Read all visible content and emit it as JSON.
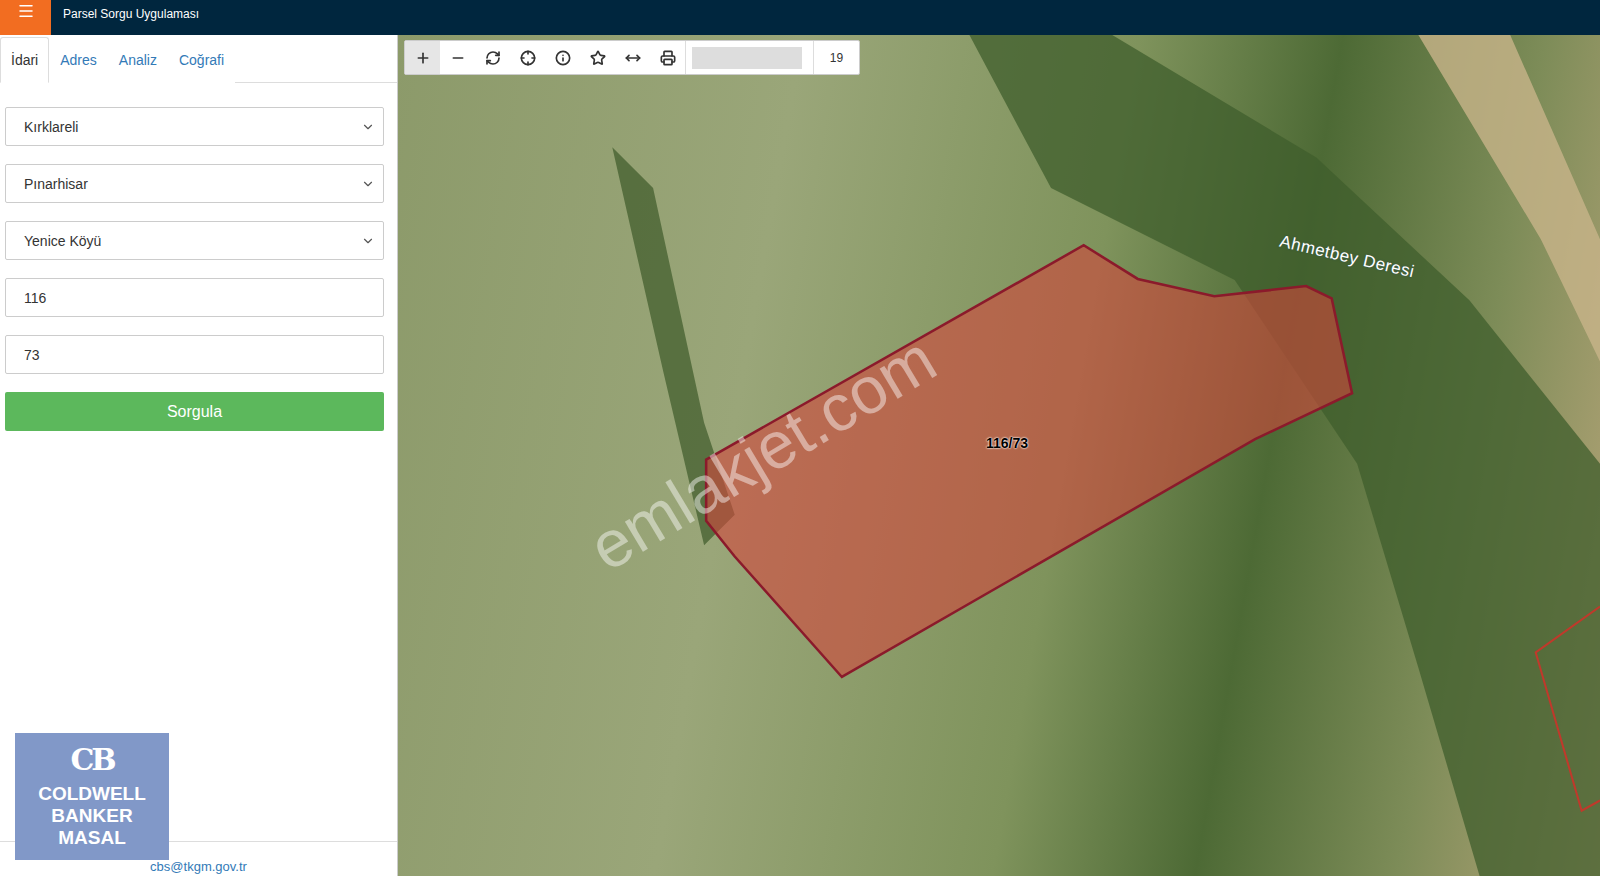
{
  "header": {
    "title": "Parsel Sorgu Uygulaması"
  },
  "tabs": [
    {
      "label": "İdari",
      "selected": true
    },
    {
      "label": "Adres",
      "selected": false
    },
    {
      "label": "Analiz",
      "selected": false
    },
    {
      "label": "Coğrafi",
      "selected": false
    }
  ],
  "form": {
    "fields": [
      {
        "kind": "select",
        "value": "Kırklareli"
      },
      {
        "kind": "select",
        "value": "Pınarhisar"
      },
      {
        "kind": "select",
        "value": "Yenice Köyü"
      },
      {
        "kind": "input",
        "value": "116"
      },
      {
        "kind": "input",
        "value": "73"
      }
    ],
    "submit": "Sorgula"
  },
  "footer": {
    "email": "cbs@tkgm.gov.tr"
  },
  "logo": {
    "monogram": "CB",
    "lines": [
      "COLDWELL",
      "BANKER",
      "MASAL"
    ]
  },
  "toolbar": {
    "zoom": "19",
    "tools": [
      {
        "name": "zoom-in",
        "selected": true
      },
      {
        "name": "zoom-out",
        "selected": false
      },
      {
        "name": "refresh",
        "selected": false
      },
      {
        "name": "locate",
        "selected": false
      },
      {
        "name": "info",
        "selected": false
      },
      {
        "name": "favorite",
        "selected": false
      },
      {
        "name": "measure",
        "selected": false
      },
      {
        "name": "print",
        "selected": false
      }
    ]
  },
  "map": {
    "parcel_label": "116/73",
    "stream_label": "Ahmetbey Deresi",
    "watermark": "emlakjet.com"
  }
}
